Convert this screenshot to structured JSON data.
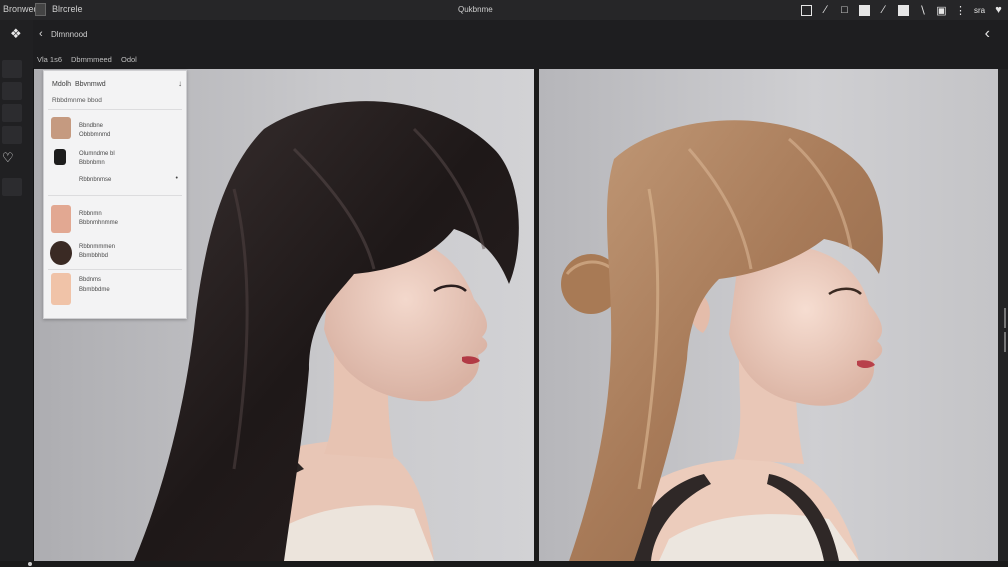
{
  "app": {
    "name": "Bronwed",
    "file_label": "Blrcrele",
    "document_title": "Qukbnme"
  },
  "toolbar": {
    "text_tool_label": "sra"
  },
  "subbar": {
    "label": "Dlmnnood"
  },
  "pathbar": {
    "segments": [
      "Vla 1s6",
      "Dbmmmeed",
      "Odol"
    ]
  },
  "layers_panel": {
    "title": "Mdolh",
    "title_suffix": "Bbvnmwd",
    "subtitle": "Rbbdmnme bbod",
    "layers": [
      {
        "lines": [
          "Bbndbne",
          "Obbbmnmd"
        ],
        "thumb_color": "#c59a80"
      },
      {
        "lines": [
          "Olumndme bl",
          "Bbbnbmn"
        ],
        "thumb_color": "#1d1d1d"
      },
      {
        "lines": [
          "Rbbnbnmse"
        ],
        "thumb_color": ""
      },
      {
        "lines": [
          "Rbbnmn",
          "Bbbnmhnmme"
        ],
        "thumb_color": "#e2a892"
      },
      {
        "lines": [
          "Rbbnmmmen",
          "Bbmbbhbd"
        ],
        "thumb_color": "#3a2a24"
      },
      {
        "lines": [
          "Bbdnms",
          "Bbmbbdme"
        ],
        "thumb_color": "#f0c3a8"
      }
    ]
  },
  "colors": {
    "chrome_dark": "#1d1d1f",
    "panel_bg": "#f3f3f4",
    "canvas_left": "#c0c0c3",
    "canvas_right": "#c6c6c9"
  }
}
